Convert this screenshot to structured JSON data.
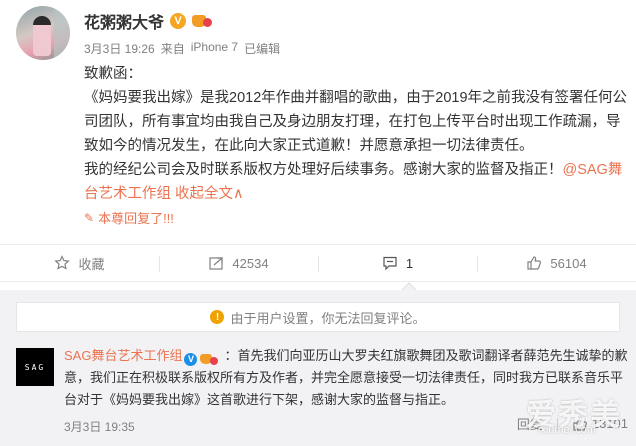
{
  "post": {
    "username": "花粥粥大爷",
    "vip_badge": "V",
    "time": "3月3日 19:26",
    "source_prefix": "来自",
    "source": "iPhone 7",
    "edited": "已编辑",
    "paragraphs": [
      "致歉函：",
      "《妈妈要我出嫁》是我2012年作曲并翻唱的歌曲，由于2019年之前我没有签署任何公司团队，所有事宜均由我自己及身边朋友打理，在打包上传平台时出现工作疏漏，导致如今的情况发生，在此向大家正式道歉！并愿意承担一切法律责任。",
      "我的经纪公司会及时联系版权方处理好后续事务。感谢大家的监督及指正！"
    ],
    "mention": "@SAG舞台艺术工作组",
    "collapse_link": "收起全文",
    "collapse_arrow": "∧",
    "reply_note": "本尊回复了!!!"
  },
  "actions": [
    {
      "name": "favorite",
      "label": "收藏",
      "icon": "star-icon"
    },
    {
      "name": "repost",
      "label": "42534",
      "icon": "repost-icon"
    },
    {
      "name": "comment",
      "label": "1",
      "icon": "comment-icon"
    },
    {
      "name": "like",
      "label": "56104",
      "icon": "thumbs-up-icon"
    }
  ],
  "comments_section": {
    "notice": "由于用户设置，你无法回复评论。",
    "comment": {
      "avatar_text": "SAG",
      "author": "SAG舞台艺术工作组",
      "vip_badge": "V",
      "text": "：首先我们向亚历山大罗夫红旗歌舞团及歌词翻译者薛范先生诚挚的歉意，我们正在积极联系版权所有方及作者，并完全愿意接受一切法律责任，同时我方已联系音乐平台对于《妈妈要我出嫁》这首歌进行下架，感谢大家的监督与指正。",
      "time": "3月3日 19:35",
      "reply_label": "回复",
      "like_count": "13101"
    }
  },
  "watermark": {
    "main": "爱秀美",
    "sub": "ixiumei.com"
  },
  "colors": {
    "accent": "#eb7350",
    "vip": "#f5a623",
    "muted": "#808080"
  }
}
